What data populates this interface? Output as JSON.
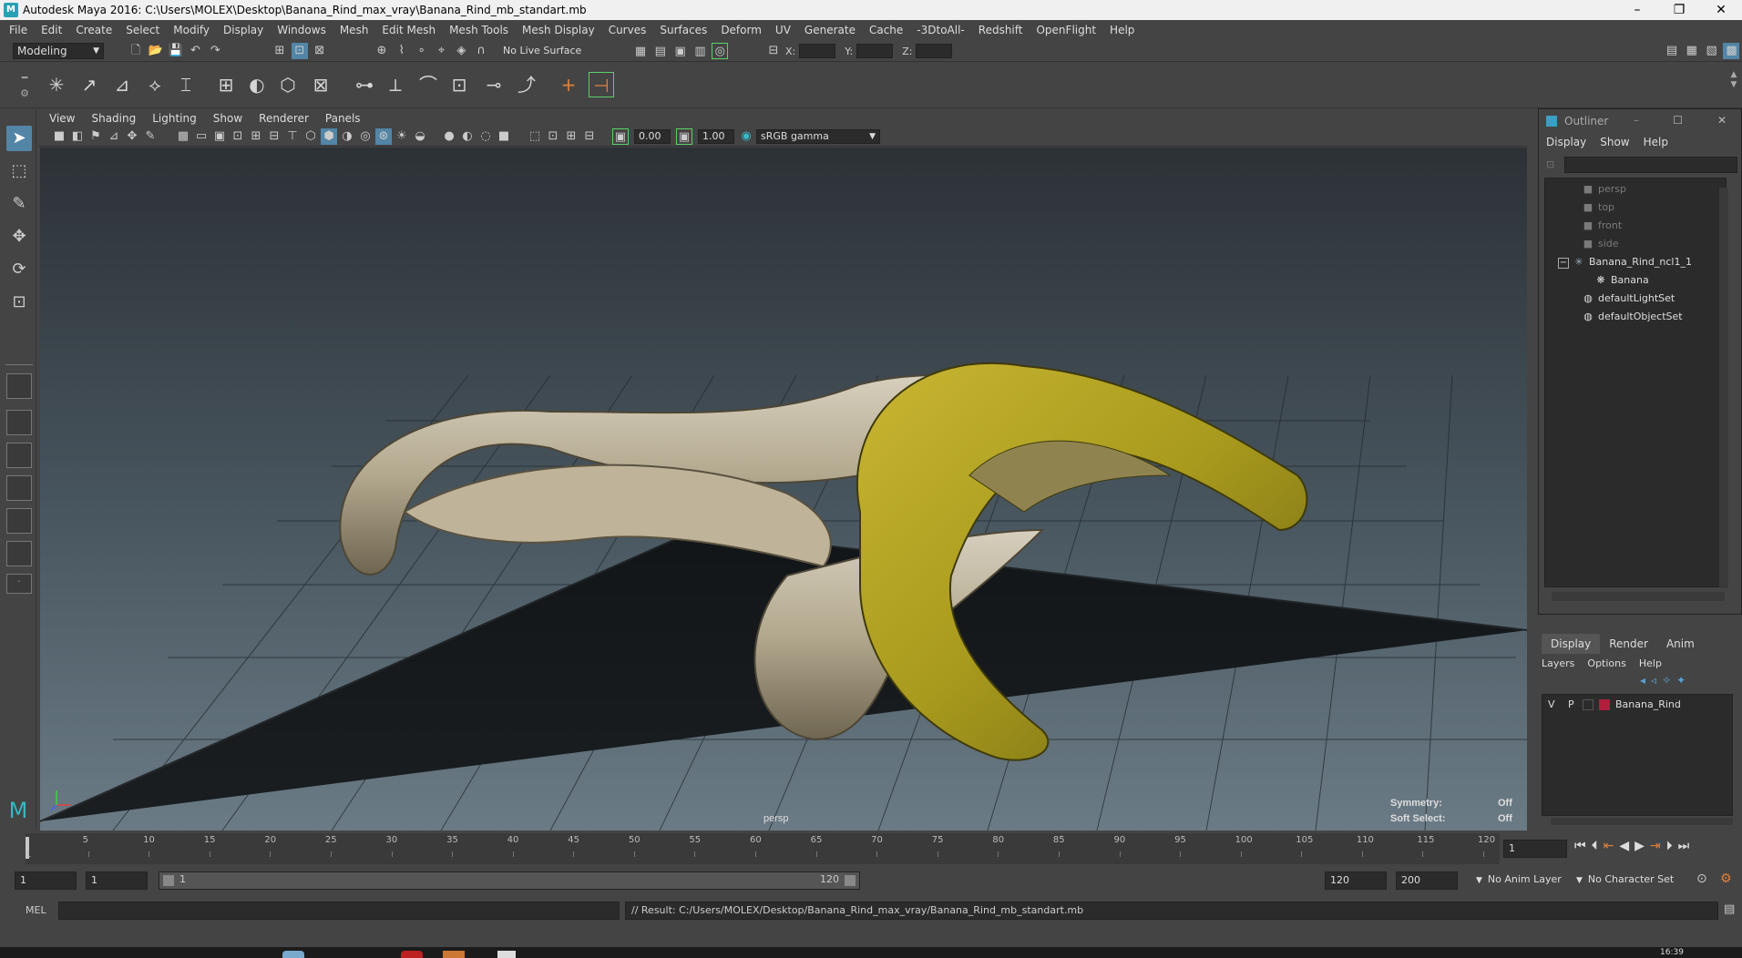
{
  "window": {
    "title": "Autodesk Maya 2016: C:\\Users\\MOLEX\\Desktop\\Banana_Rind_max_vray\\Banana_Rind_mb_standart.mb",
    "minimize": "–",
    "restore": "❐",
    "close": "✕"
  },
  "menubar": [
    "File",
    "Edit",
    "Create",
    "Select",
    "Modify",
    "Display",
    "Windows",
    "Mesh",
    "Edit Mesh",
    "Mesh Tools",
    "Mesh Display",
    "Curves",
    "Surfaces",
    "Deform",
    "UV",
    "Generate",
    "Cache",
    "-3DtoAll-",
    "Redshift",
    "OpenFlight",
    "Help"
  ],
  "statusline": {
    "mode": "Modeling",
    "live_surface": "No Live Surface",
    "x_label": "X:",
    "y_label": "Y:",
    "z_label": "Z:"
  },
  "viewport": {
    "menu": [
      "View",
      "Shading",
      "Lighting",
      "Show",
      "Renderer",
      "Panels"
    ],
    "exposure": "0.00",
    "gamma": "1.00",
    "color_space": "sRGB gamma",
    "camera": "persp",
    "symmetry_label": "Symmetry:",
    "symmetry_value": "Off",
    "soft_select_label": "Soft Select:",
    "soft_select_value": "Off"
  },
  "outliner": {
    "title": "Outliner",
    "menu": [
      "Display",
      "Show",
      "Help"
    ],
    "items": [
      {
        "label": "persp",
        "dim": true
      },
      {
        "label": "top",
        "dim": true
      },
      {
        "label": "front",
        "dim": true
      },
      {
        "label": "side",
        "dim": true
      },
      {
        "label": "Banana_Rind_ncl1_1",
        "dim": false
      },
      {
        "label": "Banana",
        "dim": false
      },
      {
        "label": "defaultLightSet",
        "dim": false
      },
      {
        "label": "defaultObjectSet",
        "dim": false
      }
    ]
  },
  "layer_editor": {
    "tabs": [
      "Display",
      "Render",
      "Anim"
    ],
    "menu": [
      "Layers",
      "Options",
      "Help"
    ],
    "layer": {
      "v": "V",
      "p": "P",
      "name": "Banana_Rind",
      "color": "#b01e3c"
    }
  },
  "timeline": {
    "ticks": [
      "5",
      "10",
      "15",
      "20",
      "25",
      "30",
      "35",
      "40",
      "45",
      "50",
      "55",
      "60",
      "65",
      "70",
      "75",
      "80",
      "85",
      "90",
      "95",
      "100",
      "105",
      "110",
      "115",
      "120"
    ],
    "current_frame": "1",
    "start_marker": "1"
  },
  "range": {
    "start": "1",
    "playback_start": "1",
    "slider_start": "1",
    "slider_end": "120",
    "playback_end": "120",
    "end": "200",
    "anim_layer": "No Anim Layer",
    "character_set": "No Character Set"
  },
  "command": {
    "language": "MEL",
    "result": "// Result: C:/Users/MOLEX/Desktop/Banana_Rind_max_vray/Banana_Rind_mb_standart.mb"
  },
  "clock": "16:39"
}
